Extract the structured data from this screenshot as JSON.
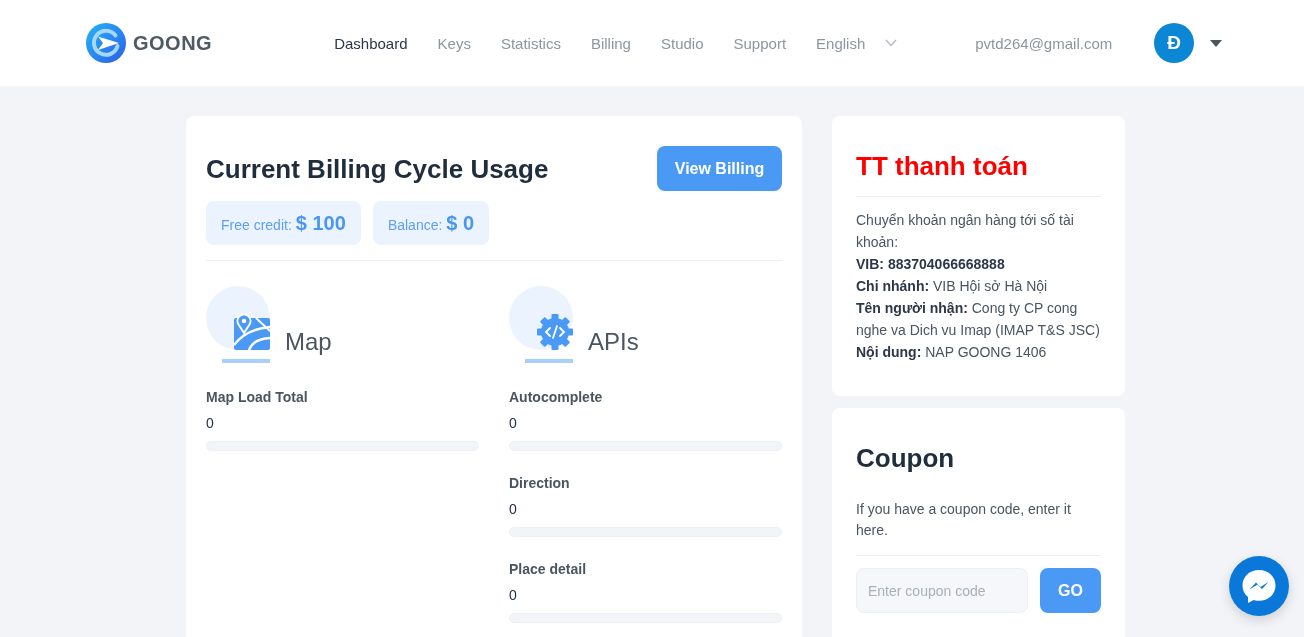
{
  "header": {
    "logo": {
      "name": "GOONG"
    },
    "nav": [
      {
        "label": "Dashboard",
        "selected": true
      },
      {
        "label": "Keys",
        "selected": false
      },
      {
        "label": "Statistics",
        "selected": false
      },
      {
        "label": "Billing",
        "selected": false
      },
      {
        "label": "Studio",
        "selected": false
      },
      {
        "label": "Support",
        "selected": false
      }
    ],
    "language": {
      "label": "English"
    },
    "user": {
      "email": "pvtd264@gmail.com",
      "avatar_initial": "Đ"
    }
  },
  "usage": {
    "title": "Current Billing Cycle Usage",
    "button": "View Billing",
    "summaries": [
      {
        "label": "Free credit:",
        "value": "$ 100"
      },
      {
        "label": "Balance:",
        "value": "$ 0"
      }
    ],
    "groups": [
      {
        "kind": "map",
        "title": "Map",
        "metrics": [
          {
            "name": "Map Load Total",
            "value": "0",
            "level": 0
          }
        ]
      },
      {
        "kind": "api",
        "title": "APIs",
        "metrics": [
          {
            "name": "Autocomplete",
            "value": "0",
            "level": 0
          },
          {
            "name": "Direction",
            "value": "0",
            "level": 0
          },
          {
            "name": "Place detail",
            "value": "0",
            "level": 0
          }
        ]
      }
    ]
  },
  "payment": {
    "title": "TT thanh toán",
    "intro": "Chuyển khoản ngân hàng tới số tài khoản:",
    "details": [
      {
        "label": "VIB: 883704066668888"
      },
      {
        "label": "Chi nhánh:",
        "value": "VIB Hội sở Hà Nội"
      },
      {
        "label": "Tên người nhận:",
        "value": "Cong ty CP cong nghe va Dich vu Imap (IMAP T&S JSC)"
      },
      {
        "label": "Nội dung:",
        "value": "NAP GOONG 1406"
      }
    ]
  },
  "coupon": {
    "title": "Coupon",
    "text": "If you have a coupon code, enter it here.",
    "input": {
      "placeholder": "Enter coupon code"
    },
    "button": "GO"
  }
}
